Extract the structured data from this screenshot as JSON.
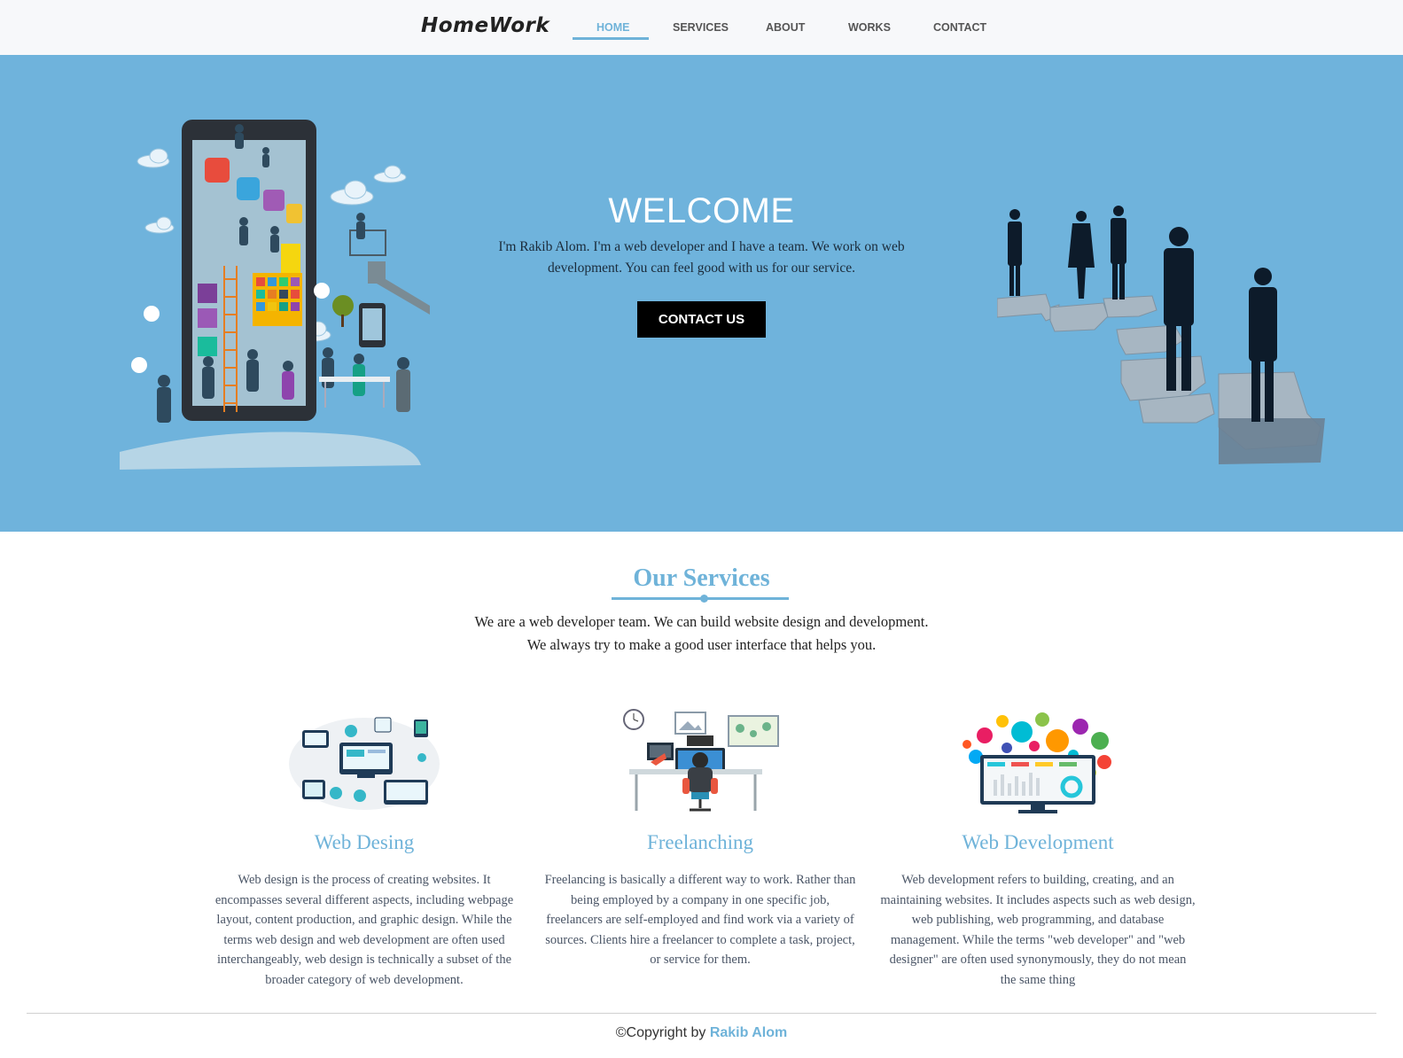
{
  "header": {
    "logo": "HomeWork",
    "nav": [
      {
        "label": "HOME",
        "active": true
      },
      {
        "label": "SERVICES",
        "active": false
      },
      {
        "label": "ABOUT",
        "active": false
      },
      {
        "label": "WORKS",
        "active": false
      },
      {
        "label": "CONTACT",
        "active": false
      }
    ]
  },
  "hero": {
    "title": "WELCOME",
    "text": "I'm Rakib Alom. I'm a web developer and I have a team. We work on web development. You can feel good with us for our service.",
    "button": "CONTACT US",
    "left_illustration": "tablet-team-illustration",
    "right_illustration": "business-people-puzzle-illustration"
  },
  "services": {
    "title": "Our Services",
    "intro_line1": "We are a web developer team. We can build website design and development.",
    "intro_line2": "We always try to make a good user interface that helps you.",
    "items": [
      {
        "title": "Web Desing",
        "icon": "web-design-illustration",
        "text": "Web design is the process of creating websites. It encompasses several different aspects, including webpage layout, content production, and graphic design. While the terms web design and web development are often used interchangeably, web design is technically a subset of the broader category of web development."
      },
      {
        "title": "Freelanching",
        "icon": "freelancer-desk-illustration",
        "text": "Freelancing is basically a different way to work. Rather than being employed by a company in one specific job, freelancers are self-employed and find work via a variety of sources. Clients hire a freelancer to complete a task, project, or service for them."
      },
      {
        "title": "Web Development",
        "icon": "web-development-monitor-illustration",
        "text": "Web development refers to building, creating, and an maintaining websites. It includes aspects such as web design, web publishing, web programming, and database management. While the terms \"web developer\" and \"web designer\" are often used synonymously, they do not mean the same thing"
      }
    ]
  },
  "footer": {
    "prefix": "©Copyright by",
    "author": "Rakib Alom"
  },
  "colors": {
    "accent": "#6fb3d9",
    "hero_bg": "#6fb3dc",
    "button_bg": "#000000"
  }
}
